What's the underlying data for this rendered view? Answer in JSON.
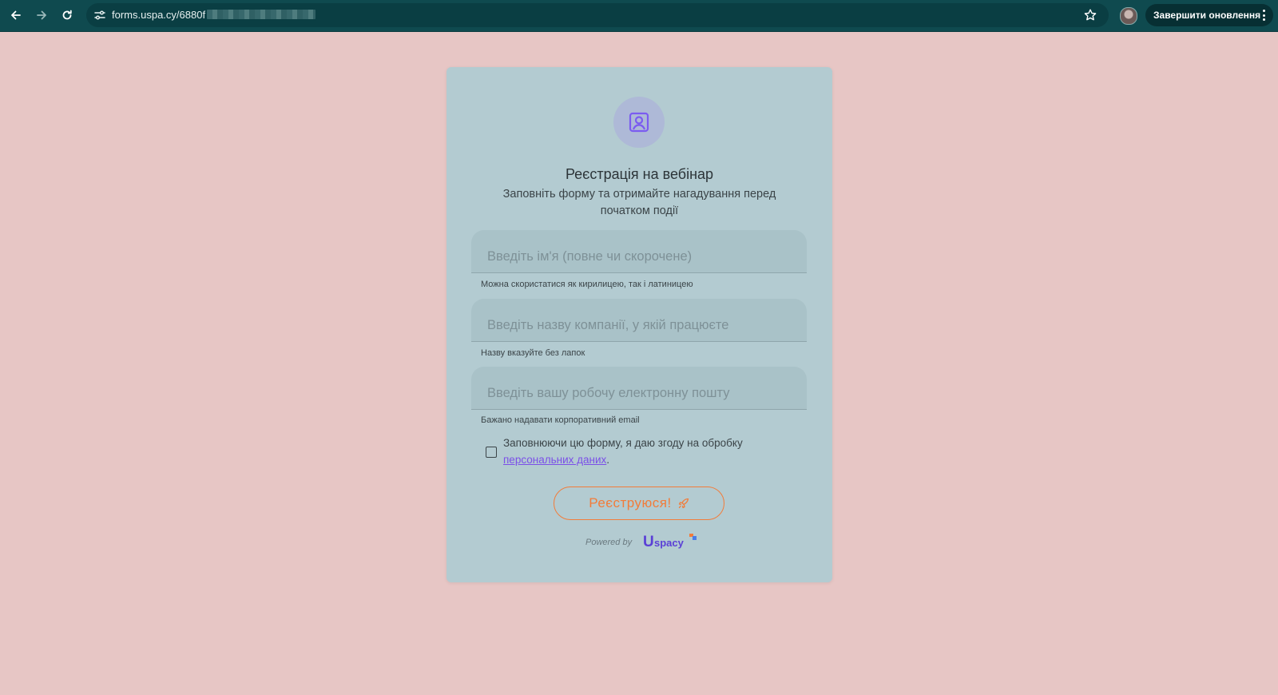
{
  "browser": {
    "url": "forms.uspa.cy/6880f",
    "update_button_label": "Завершити оновлення",
    "icons": [
      "back-arrow-icon",
      "forward-arrow-icon",
      "reload-icon",
      "site-info-icon",
      "star-icon",
      "kebab-menu-icon"
    ]
  },
  "form": {
    "title": "Реєстрація на вебінар",
    "subtitle": "Заповніть форму та отримайте нагадування перед початком події",
    "fields": [
      {
        "placeholder": "Введіть ім'я (повне чи скорочене)",
        "value": "",
        "hint": "Можна скористатися як кирилицею, так і латиницею"
      },
      {
        "placeholder": "Введіть назву компанії, у якій працюєте",
        "value": "",
        "hint": "Назву вказуйте без лапок"
      },
      {
        "placeholder": "Введіть вашу робочу електронну пошту",
        "value": "",
        "hint": "Бажано надавати корпоративний email"
      }
    ],
    "consent": {
      "text": "Заповнюючи цю форму, я даю згоду на обробку",
      "link": "персональних даних",
      "suffix": ".",
      "checked": false
    },
    "submit_label": "Реєструюся!",
    "powered_by": "Powered by",
    "logo_u": "U",
    "logo_text": "spacy",
    "colors": {
      "page_bg": "#e7c6c5",
      "card_bg": "#b3cbd1",
      "accent": "#f27c3a",
      "link": "#7b4fe8",
      "chrome": "#0f4a4f"
    }
  }
}
